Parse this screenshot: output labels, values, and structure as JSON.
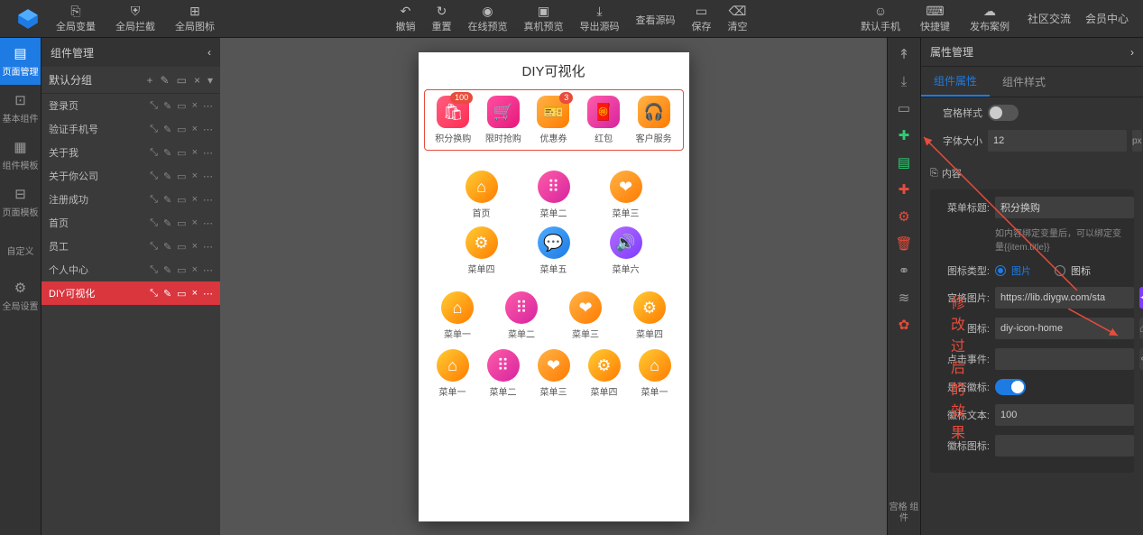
{
  "topbar": {
    "left": [
      {
        "icon": "⎘",
        "label": "全局变量"
      },
      {
        "icon": "⛨",
        "label": "全局拦截"
      },
      {
        "icon": "⊞",
        "label": "全局图标"
      }
    ],
    "center": [
      {
        "icon": "↶",
        "label": "撤销"
      },
      {
        "icon": "↻",
        "label": "重置"
      },
      {
        "icon": "◉",
        "label": "在线预览"
      },
      {
        "icon": "▣",
        "label": "真机预览"
      },
      {
        "icon": "⤓",
        "label": "导出源码"
      },
      {
        "icon": "</>",
        "label": "查看源码"
      },
      {
        "icon": "▭",
        "label": "保存"
      },
      {
        "icon": "⌫",
        "label": "清空"
      }
    ],
    "right": [
      {
        "icon": "☺",
        "label": "默认手机"
      },
      {
        "icon": "⌨",
        "label": "快捷键"
      },
      {
        "icon": "☁",
        "label": "发布案例"
      }
    ],
    "links": [
      "社区交流",
      "会员中心"
    ]
  },
  "left_tabs": [
    {
      "icon": "▤",
      "label": "页面管理",
      "active": true
    },
    {
      "icon": "⊡",
      "label": "基本组件"
    },
    {
      "icon": "▦",
      "label": "组件模板"
    },
    {
      "icon": "⊟",
      "label": "页面模板"
    },
    {
      "icon": "</>",
      "label": "自定义"
    },
    {
      "icon": "⚙",
      "label": "全局设置"
    }
  ],
  "panel": {
    "title": "组件管理",
    "group_label": "默认分组",
    "group_tools": [
      "+",
      "✎",
      "▭",
      "×",
      "▾"
    ],
    "pages": [
      {
        "name": "登录页"
      },
      {
        "name": "验证手机号"
      },
      {
        "name": "关于我"
      },
      {
        "name": "关于你公司"
      },
      {
        "name": "注册成功"
      },
      {
        "name": "首页"
      },
      {
        "name": "员工"
      },
      {
        "name": "个人中心"
      },
      {
        "name": "DIY可视化",
        "active": true
      }
    ],
    "page_tools": [
      "⤡",
      "✎",
      "▭",
      "×",
      "⋯"
    ]
  },
  "phone": {
    "title": "DIY可视化",
    "row1": [
      {
        "label": "积分换购",
        "icon": "🛍",
        "badge": "100",
        "cls": "g-red"
      },
      {
        "label": "限时抢购",
        "icon": "🛒",
        "cls": "g-pink"
      },
      {
        "label": "优惠券",
        "icon": "🎫",
        "badge": "3",
        "cls": "g-orange"
      },
      {
        "label": "红包",
        "icon": "🧧",
        "cls": "g-mag"
      },
      {
        "label": "客户服务",
        "icon": "🎧",
        "cls": "g-orange"
      }
    ],
    "row2": [
      {
        "label": "首页",
        "icon": "⌂",
        "cls": "g-yorange"
      },
      {
        "label": "菜单二",
        "icon": "⠿",
        "cls": "g-mag"
      },
      {
        "label": "菜单三",
        "icon": "❤",
        "cls": "g-orange"
      }
    ],
    "row3": [
      {
        "label": "菜单四",
        "icon": "⚙",
        "cls": "g-yorange"
      },
      {
        "label": "菜单五",
        "icon": "💬",
        "cls": "g-blue"
      },
      {
        "label": "菜单六",
        "icon": "🔊",
        "cls": "g-purple"
      }
    ],
    "row4": [
      {
        "label": "菜单一",
        "icon": "⌂",
        "cls": "g-yorange"
      },
      {
        "label": "菜单二",
        "icon": "⠿",
        "cls": "g-mag"
      },
      {
        "label": "菜单三",
        "icon": "❤",
        "cls": "g-orange"
      },
      {
        "label": "菜单四",
        "icon": "⚙",
        "cls": "g-yorange"
      }
    ],
    "row5": [
      {
        "label": "菜单一",
        "icon": "⌂",
        "cls": "g-yorange"
      },
      {
        "label": "菜单二",
        "icon": "⠿",
        "cls": "g-mag"
      },
      {
        "label": "菜单三",
        "icon": "❤",
        "cls": "g-orange"
      },
      {
        "label": "菜单四",
        "icon": "⚙",
        "cls": "g-yorange"
      },
      {
        "label": "菜单一",
        "icon": "⌂",
        "cls": "g-yorange"
      }
    ]
  },
  "annotation": "修改过后的效果",
  "toolcol": [
    {
      "icon": "↟",
      "color": ""
    },
    {
      "icon": "⤓",
      "color": ""
    },
    {
      "icon": "▭",
      "color": ""
    },
    {
      "icon": "✚",
      "color": "green"
    },
    {
      "icon": "▤",
      "color": "green"
    },
    {
      "icon": "✚",
      "color": "red"
    },
    {
      "icon": "⚙",
      "color": "red"
    },
    {
      "icon": "🗑",
      "color": "red"
    },
    {
      "icon": "⚭",
      "color": ""
    },
    {
      "icon": "≋",
      "color": ""
    },
    {
      "icon": "✿",
      "color": "red"
    }
  ],
  "toolcol_label": "宫格\n组件",
  "props": {
    "title": "属性管理",
    "tabs": [
      {
        "label": "组件属性",
        "active": true
      },
      {
        "label": "组件样式"
      }
    ],
    "grid_style_label": "宫格样式",
    "font_size_label": "字体大小",
    "font_size_value": "12",
    "font_size_unit": "px",
    "content_label": "内容",
    "menu_title_label": "菜单标题:",
    "menu_title_value": "积分换购",
    "hint": "如内容绑定变量后，可以绑定变量{{item.title}}",
    "icon_type_label": "图标类型:",
    "icon_type_options": [
      "图片",
      "图标"
    ],
    "grid_image_label": "宫格图片:",
    "grid_image_value": "https://lib.diygw.com/sta",
    "icon_label": "图标:",
    "icon_value": "diy-icon-home",
    "click_label": "点击事件:",
    "click_value": "",
    "badge_on_label": "是否徽标:",
    "badge_text_label": "徽标文本:",
    "badge_text_value": "100",
    "badge_icon_label": "徽标图标:"
  }
}
